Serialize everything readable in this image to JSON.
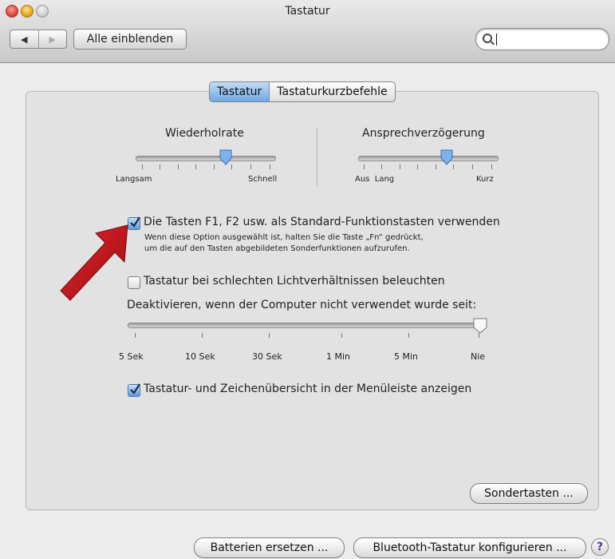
{
  "window": {
    "title": "Tastatur"
  },
  "toolbar": {
    "back_glyph": "◀",
    "forward_glyph": "▶",
    "show_all_label": "Alle einblenden",
    "search_value": ""
  },
  "tabs": [
    {
      "label": "Tastatur",
      "active": true
    },
    {
      "label": "Tastaturkurzbefehle",
      "active": false
    }
  ],
  "repeat_rate": {
    "label": "Wiederholrate",
    "min_label": "Langsam",
    "max_label": "Schnell",
    "level": 0.75
  },
  "repeat_delay": {
    "label": "Ansprechverzögerung",
    "min_labels": "Aus  Lang",
    "max_label": "Kurz",
    "level": 0.6
  },
  "fn_keys": {
    "checked": true,
    "label": "Die Tasten F1, F2 usw. als Standard-Funktionstasten verwenden",
    "desc_line1": "Wenn diese Option ausgewählt ist, halten Sie die Taste „Fn“ gedrückt,",
    "desc_line2": "um die auf den Tasten abgebildeten Sonderfunktionen aufzurufen."
  },
  "backlight": {
    "checked": false,
    "label": "Tastatur bei schlechten Lichtverhältnissen beleuchten",
    "deactivate_label": "Deaktivieren, wenn der Computer nicht verwendet wurde seit:",
    "ticks": [
      "5 Sek",
      "10 Sek",
      "30 Sek",
      "1 Min",
      "5 Min",
      "Nie"
    ],
    "level": 1.0
  },
  "viewer": {
    "checked": true,
    "label": "Tastatur- und Zeichenübersicht in der Menüleiste anzeigen"
  },
  "buttons": {
    "modifier": "Sondertasten ...",
    "batteries": "Batterien ersetzen ...",
    "bluetooth": "Bluetooth-Tastatur konfigurieren ...",
    "help": "?"
  },
  "colors": {
    "accent": "#5d9be0",
    "annotation_arrow": "#c8161d"
  }
}
